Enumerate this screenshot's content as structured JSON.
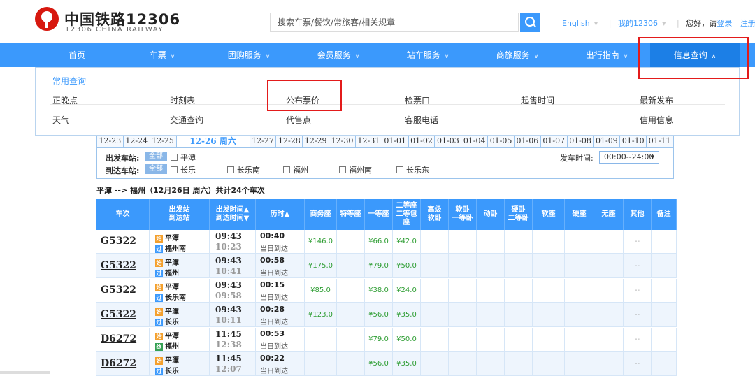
{
  "header": {
    "logo_cn": "中国铁路12306",
    "logo_en": "12306 CHINA RAILWAY",
    "search_placeholder": "搜索车票/餐饮/常旅客/相关规章",
    "links": {
      "english": "English",
      "my12306": "我的12306",
      "greeting": "您好，请",
      "login": "登录",
      "register": "注册"
    }
  },
  "nav": {
    "items": [
      "首页",
      "车票",
      "团购服务",
      "会员服务",
      "站车服务",
      "商旅服务",
      "出行指南",
      "信息查询"
    ],
    "active": "信息查询"
  },
  "dropdown": {
    "title": "常用查询",
    "row1": [
      "正晚点",
      "时刻表",
      "公布票价",
      "检票口",
      "起售时间",
      "最新发布"
    ],
    "row2": [
      "天气",
      "交通查询",
      "代售点",
      "客服电话",
      "信用信息"
    ]
  },
  "dates": [
    "12-23",
    "12-24",
    "12-25",
    "12-26 周六",
    "12-27",
    "12-28",
    "12-29",
    "12-30",
    "12-31",
    "01-01",
    "01-02",
    "01-03",
    "01-04",
    "01-05",
    "01-06",
    "01-07",
    "01-08",
    "01-09",
    "01-10",
    "01-11"
  ],
  "active_date": "12-26 周六",
  "filters": {
    "dep_label": "出发车站:",
    "arr_label": "到达车站:",
    "all_label": "全部",
    "dep_stations": [
      "平潭"
    ],
    "arr_stations": [
      "长乐",
      "长乐南",
      "福州",
      "福州南",
      "长乐东"
    ],
    "time_label": "发车时间:",
    "time_value": "00:00--24:00"
  },
  "summary": "平潭 --> 福州（12月26日 周六）共计24个车次",
  "table": {
    "headers": [
      "车次",
      "出发站\n到达站",
      "出发时间▲\n到达时间▼",
      "历时▲",
      "商务座",
      "特等座",
      "一等座",
      "二等座\n二等包座",
      "高级\n软卧",
      "软卧\n一等卧",
      "动卧",
      "硬卧\n二等卧",
      "软座",
      "硬座",
      "无座",
      "其他",
      "备注"
    ],
    "badges": {
      "start": "始",
      "pass": "过",
      "end": "终"
    },
    "rows": [
      {
        "train": "G5322",
        "from": "平潭",
        "from_badge": "始",
        "to": "福州南",
        "to_badge": "过",
        "dep": "09:43",
        "arr": "10:23",
        "dur": "00:40",
        "arrive_day": "当日到达",
        "business": "¥146.0",
        "first": "¥66.0",
        "second": "¥42.0",
        "other": "--"
      },
      {
        "train": "G5322",
        "from": "平潭",
        "from_badge": "始",
        "to": "福州",
        "to_badge": "过",
        "dep": "09:43",
        "arr": "10:41",
        "dur": "00:58",
        "arrive_day": "当日到达",
        "business": "¥175.0",
        "first": "¥79.0",
        "second": "¥50.0",
        "other": "--"
      },
      {
        "train": "G5322",
        "from": "平潭",
        "from_badge": "始",
        "to": "长乐南",
        "to_badge": "过",
        "dep": "09:43",
        "arr": "09:58",
        "dur": "00:15",
        "arrive_day": "当日到达",
        "business": "¥85.0",
        "first": "¥38.0",
        "second": "¥24.0",
        "other": "--"
      },
      {
        "train": "G5322",
        "from": "平潭",
        "from_badge": "始",
        "to": "长乐",
        "to_badge": "过",
        "dep": "09:43",
        "arr": "10:11",
        "dur": "00:28",
        "arrive_day": "当日到达",
        "business": "¥123.0",
        "first": "¥56.0",
        "second": "¥35.0",
        "other": "--"
      },
      {
        "train": "D6272",
        "from": "平潭",
        "from_badge": "始",
        "to": "福州",
        "to_badge": "终",
        "dep": "11:45",
        "arr": "12:38",
        "dur": "00:53",
        "arrive_day": "当日到达",
        "business": "",
        "first": "¥79.0",
        "second": "¥50.0",
        "other": "--"
      },
      {
        "train": "D6272",
        "from": "平潭",
        "from_badge": "始",
        "to": "长乐",
        "to_badge": "过",
        "dep": "11:45",
        "arr": "12:07",
        "dur": "00:22",
        "arrive_day": "当日到达",
        "business": "",
        "first": "¥56.0",
        "second": "¥35.0",
        "other": "--"
      }
    ]
  },
  "colors": {
    "primary": "#3b99fc",
    "highlight": "#e31b1b",
    "price": "#2d9d32"
  }
}
